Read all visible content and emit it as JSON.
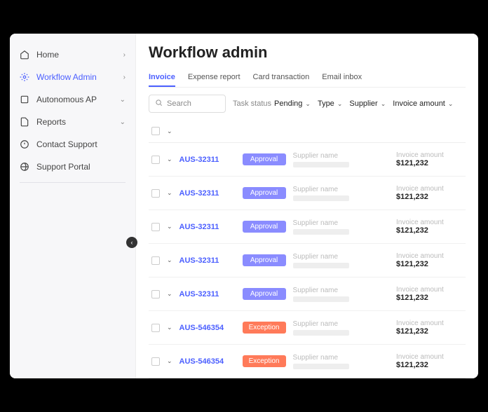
{
  "sidebar": {
    "items": [
      {
        "label": "Home",
        "chev": "›"
      },
      {
        "label": "Workflow Admin",
        "chev": "›",
        "active": true
      },
      {
        "label": "Autonomous AP",
        "chev": "⌄"
      },
      {
        "label": "Reports",
        "chev": "⌄"
      },
      {
        "label": "Contact Support",
        "chev": ""
      },
      {
        "label": "Support Portal",
        "chev": ""
      }
    ]
  },
  "page": {
    "title": "Workflow admin"
  },
  "tabs": [
    {
      "label": "Invoice",
      "active": true
    },
    {
      "label": "Expense report"
    },
    {
      "label": "Card transaction"
    },
    {
      "label": "Email inbox"
    }
  ],
  "search": {
    "placeholder": "Search"
  },
  "filters": {
    "task_status": {
      "label": "Task status",
      "value": "Pending"
    },
    "type": {
      "label": "Type"
    },
    "supplier": {
      "label": "Supplier"
    },
    "invoice_amount": {
      "label": "Invoice amount"
    }
  },
  "headers": {
    "supplier": "Supplier name",
    "amount": "Invoice amount"
  },
  "rows": [
    {
      "id": "AUS-32311",
      "status": "Approval",
      "status_kind": "approval",
      "amount": "$121,232"
    },
    {
      "id": "AUS-32311",
      "status": "Approval",
      "status_kind": "approval",
      "amount": "$121,232"
    },
    {
      "id": "AUS-32311",
      "status": "Approval",
      "status_kind": "approval",
      "amount": "$121,232"
    },
    {
      "id": "AUS-32311",
      "status": "Approval",
      "status_kind": "approval",
      "amount": "$121,232"
    },
    {
      "id": "AUS-32311",
      "status": "Approval",
      "status_kind": "approval",
      "amount": "$121,232"
    },
    {
      "id": "AUS-546354",
      "status": "Exception",
      "status_kind": "exception",
      "amount": "$121,232"
    },
    {
      "id": "AUS-546354",
      "status": "Exception",
      "status_kind": "exception",
      "amount": "$121,232"
    }
  ]
}
